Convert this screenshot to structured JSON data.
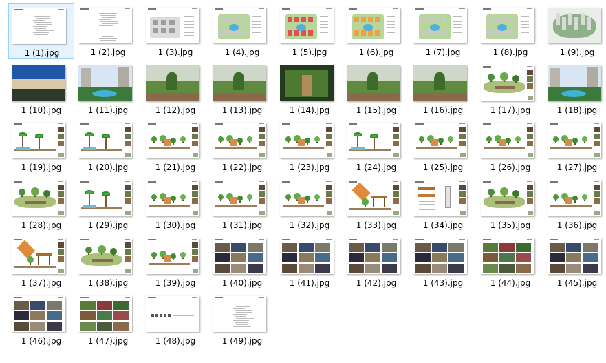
{
  "files": [
    {
      "name": "1 (1).jpg",
      "kind": "text",
      "selected": true
    },
    {
      "name": "1 (2).jpg",
      "kind": "text"
    },
    {
      "name": "1 (3).jpg",
      "kind": "plan-gray"
    },
    {
      "name": "1 (4).jpg",
      "kind": "plan-color"
    },
    {
      "name": "1 (5).jpg",
      "kind": "plan-red"
    },
    {
      "name": "1 (6).jpg",
      "kind": "plan-orange"
    },
    {
      "name": "1 (7).jpg",
      "kind": "plan-color"
    },
    {
      "name": "1 (8).jpg",
      "kind": "plan-color"
    },
    {
      "name": "1 (9).jpg",
      "kind": "aerial"
    },
    {
      "name": "1 (10).jpg",
      "kind": "photo-blue"
    },
    {
      "name": "1 (11).jpg",
      "kind": "photo-pool"
    },
    {
      "name": "1 (12).jpg",
      "kind": "photo-garden"
    },
    {
      "name": "1 (13).jpg",
      "kind": "photo-garden"
    },
    {
      "name": "1 (14).jpg",
      "kind": "photo-dark"
    },
    {
      "name": "1 (15).jpg",
      "kind": "photo-garden"
    },
    {
      "name": "1 (16).jpg",
      "kind": "photo-garden"
    },
    {
      "name": "1 (17).jpg",
      "kind": "sketch"
    },
    {
      "name": "1 (18).jpg",
      "kind": "photo-pool"
    },
    {
      "name": "1 (19).jpg",
      "kind": "palm"
    },
    {
      "name": "1 (20).jpg",
      "kind": "palm"
    },
    {
      "name": "1 (21).jpg",
      "kind": "elev"
    },
    {
      "name": "1 (22).jpg",
      "kind": "elev"
    },
    {
      "name": "1 (23).jpg",
      "kind": "elev"
    },
    {
      "name": "1 (24).jpg",
      "kind": "palm"
    },
    {
      "name": "1 (25).jpg",
      "kind": "elev"
    },
    {
      "name": "1 (26).jpg",
      "kind": "elev"
    },
    {
      "name": "1 (27).jpg",
      "kind": "elev"
    },
    {
      "name": "1 (28).jpg",
      "kind": "sketch"
    },
    {
      "name": "1 (29).jpg",
      "kind": "palm"
    },
    {
      "name": "1 (30).jpg",
      "kind": "elev"
    },
    {
      "name": "1 (31).jpg",
      "kind": "elev"
    },
    {
      "name": "1 (32).jpg",
      "kind": "elev"
    },
    {
      "name": "1 (33).jpg",
      "kind": "pavilion"
    },
    {
      "name": "1 (34).jpg",
      "kind": "detail"
    },
    {
      "name": "1 (35).jpg",
      "kind": "sketch"
    },
    {
      "name": "1 (36).jpg",
      "kind": "elev"
    },
    {
      "name": "1 (37).jpg",
      "kind": "pavilion"
    },
    {
      "name": "1 (38).jpg",
      "kind": "sketch"
    },
    {
      "name": "1 (39).jpg",
      "kind": "elev"
    },
    {
      "name": "1 (40).jpg",
      "kind": "collage"
    },
    {
      "name": "1 (41).jpg",
      "kind": "collage"
    },
    {
      "name": "1 (42).jpg",
      "kind": "collage"
    },
    {
      "name": "1 (43).jpg",
      "kind": "collage"
    },
    {
      "name": "1 (44).jpg",
      "kind": "collage-green"
    },
    {
      "name": "1 (45).jpg",
      "kind": "collage"
    },
    {
      "name": "1 (46).jpg",
      "kind": "collage"
    },
    {
      "name": "1 (47).jpg",
      "kind": "collage-green"
    },
    {
      "name": "1 (48).jpg",
      "kind": "sparse"
    },
    {
      "name": "1 (49).jpg",
      "kind": "text"
    }
  ]
}
